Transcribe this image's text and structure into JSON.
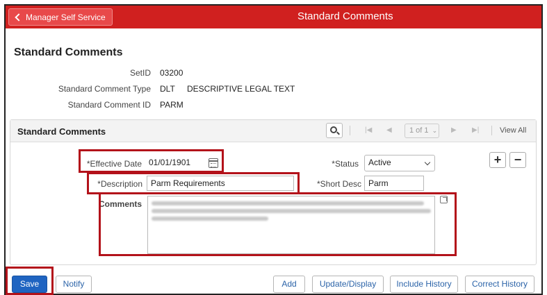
{
  "header": {
    "back_label": "Manager Self Service",
    "title": "Standard Comments"
  },
  "page": {
    "title": "Standard Comments"
  },
  "summary": {
    "setid_label": "SetID",
    "setid_value": "03200",
    "type_label": "Standard Comment Type",
    "type_code": "DLT",
    "type_desc": "DESCRIPTIVE LEGAL TEXT",
    "id_label": "Standard Comment ID",
    "id_value": "PARM"
  },
  "grid": {
    "title": "Standard Comments",
    "pager": "1 of 1",
    "view_all": "View All"
  },
  "form": {
    "effective_date_label": "*Effective Date",
    "effective_date_value": "01/01/1901",
    "status_label": "*Status",
    "status_value": "Active",
    "description_label": "*Description",
    "description_value": "Parm Requirements",
    "short_desc_label": "*Short Desc",
    "short_desc_value": "Parm",
    "comments_label": "Comments",
    "add_row": "+",
    "delete_row": "−"
  },
  "buttons": {
    "save": "Save",
    "notify": "Notify",
    "add": "Add",
    "update_display": "Update/Display",
    "include_history": "Include History",
    "correct_history": "Correct History"
  },
  "colors": {
    "header": "#d0201f",
    "highlight": "#b3121a",
    "primary": "#1f64c1"
  }
}
